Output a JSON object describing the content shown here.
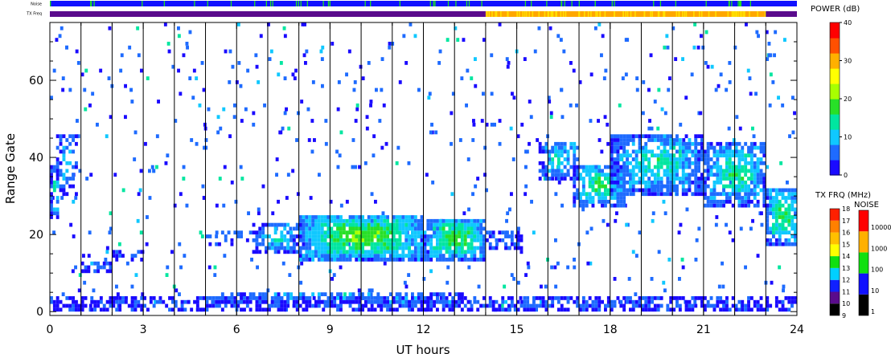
{
  "chart_data": {
    "type": "heatmap",
    "xlabel": "UT hours",
    "ylabel": "Range Gate",
    "x_ticks": [
      0,
      3,
      6,
      9,
      12,
      15,
      18,
      21,
      24
    ],
    "y_ticks": [
      0,
      20,
      40,
      60
    ],
    "xlim": [
      0,
      24
    ],
    "ylim": [
      -1,
      75
    ],
    "strip_labels": {
      "noise": "Noise",
      "txfreq": "TX Freq"
    },
    "txfreq_strip": [
      {
        "start": 0,
        "end": 14,
        "level": 10
      },
      {
        "start": 14,
        "end": 23,
        "level": 14
      },
      {
        "start": 23,
        "end": 24,
        "level": 10
      }
    ],
    "echo_regions": [
      {
        "t0": 0.0,
        "t1": 0.25,
        "g0": 24,
        "g1": 38,
        "power": 12,
        "density": 0.75
      },
      {
        "t0": 0.2,
        "t1": 0.9,
        "g0": 30,
        "g1": 46,
        "power": 8,
        "density": 0.45
      },
      {
        "t0": 1.0,
        "t1": 2.0,
        "g0": 10,
        "g1": 13,
        "power": 6,
        "density": 0.55
      },
      {
        "t0": 2.0,
        "t1": 3.0,
        "g0": 13,
        "g1": 16,
        "power": 6,
        "density": 0.35
      },
      {
        "t0": 5.0,
        "t1": 6.5,
        "g0": 17,
        "g1": 21,
        "power": 6,
        "density": 0.35
      },
      {
        "t0": 6.5,
        "t1": 8.0,
        "g0": 15,
        "g1": 23,
        "power": 10,
        "density": 0.75
      },
      {
        "t0": 8.0,
        "t1": 12.0,
        "g0": 13,
        "g1": 25,
        "power": 16,
        "density": 0.92
      },
      {
        "t0": 12.0,
        "t1": 14.0,
        "g0": 13,
        "g1": 24,
        "power": 15,
        "density": 0.9
      },
      {
        "t0": 14.0,
        "t1": 15.2,
        "g0": 16,
        "g1": 21,
        "power": 6,
        "density": 0.6
      },
      {
        "t0": 15.7,
        "t1": 17.0,
        "g0": 34,
        "g1": 44,
        "power": 10,
        "density": 0.7
      },
      {
        "t0": 16.8,
        "t1": 18.5,
        "g0": 27,
        "g1": 38,
        "power": 13,
        "density": 0.8
      },
      {
        "t0": 18.0,
        "t1": 21.0,
        "g0": 30,
        "g1": 46,
        "power": 11,
        "density": 0.75
      },
      {
        "t0": 21.0,
        "t1": 23.0,
        "g0": 27,
        "g1": 44,
        "power": 12,
        "density": 0.75
      },
      {
        "t0": 23.0,
        "t1": 24.0,
        "g0": 17,
        "g1": 32,
        "power": 14,
        "density": 0.8
      },
      {
        "t0": 0.0,
        "t1": 24.0,
        "g0": 0,
        "g1": 4,
        "power": 5,
        "density": 0.6
      },
      {
        "t0": 5.5,
        "t1": 13.5,
        "g0": 2,
        "g1": 5,
        "power": 7,
        "density": 0.6
      }
    ],
    "vertical_lines_hours": [
      1,
      2,
      3,
      4,
      5,
      6,
      7,
      8,
      9,
      10,
      11,
      12,
      13,
      14,
      15,
      16,
      17,
      18,
      19,
      20,
      21,
      22,
      23
    ],
    "power_scale": {
      "label": "POWER (dB)",
      "min": 0,
      "max": 40,
      "ticks": [
        0,
        10,
        20,
        30,
        40
      ]
    },
    "txfreq_scale": {
      "label": "TX FRQ (MHz)",
      "levels": [
        9,
        10,
        11,
        12,
        13,
        14,
        15,
        16,
        17,
        18
      ]
    },
    "noise_scale": {
      "label": "NOISE",
      "levels": [
        1,
        10,
        100,
        1000,
        10000
      ]
    },
    "colors": {
      "noise_strip_base": "#1010ff",
      "noise_strip_tick": "#20e020",
      "txfreq_low": "#5a0b8c",
      "txfreq_mid": "#ffa800",
      "txfreq_hi": "#ffe000",
      "power_stops": [
        "#1a0aff",
        "#1e6bff",
        "#10c8ff",
        "#00e6a0",
        "#28e028",
        "#a8ff00",
        "#ffff00",
        "#ffb000",
        "#ff5000",
        "#ff0000"
      ],
      "txfreq_swatches": [
        "#000000",
        "#5a0b8c",
        "#1020ff",
        "#00d0ff",
        "#10e010",
        "#ffff00",
        "#ffc000",
        "#ff8000",
        "#ff2000"
      ],
      "noise_swatches": [
        "#000000",
        "#1010ff",
        "#10e010",
        "#ffb000",
        "#ff0000"
      ]
    }
  }
}
